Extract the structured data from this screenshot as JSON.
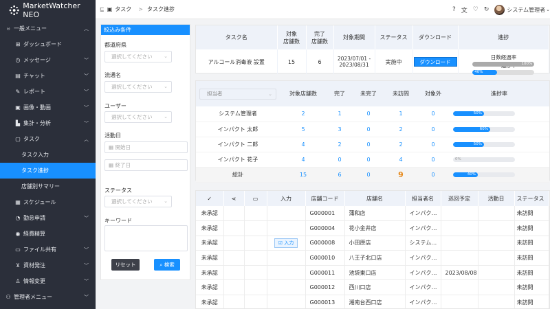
{
  "app": {
    "name": "MarketWatcher NEO"
  },
  "sidebar": {
    "items": [
      {
        "label": "一般メニュー",
        "level": 0,
        "icon": "user-icon",
        "chevron": "up"
      },
      {
        "label": "ダッシュボード",
        "level": 1,
        "icon": "grid-icon",
        "chevron": ""
      },
      {
        "label": "メッセージ",
        "level": 1,
        "icon": "message-icon",
        "chevron": "down"
      },
      {
        "label": "チャット",
        "level": 1,
        "icon": "chat-icon",
        "chevron": "down"
      },
      {
        "label": "レポート",
        "level": 1,
        "icon": "pen-icon",
        "chevron": "down"
      },
      {
        "label": "画像・動画",
        "level": 1,
        "icon": "image-icon",
        "chevron": "down"
      },
      {
        "label": "集計・分析",
        "level": 1,
        "icon": "chart-icon",
        "chevron": "down"
      },
      {
        "label": "タスク",
        "level": 1,
        "icon": "task-icon",
        "chevron": "up"
      },
      {
        "label": "タスク入力",
        "level": 2,
        "icon": "",
        "chevron": ""
      },
      {
        "label": "タスク進捗",
        "level": 2,
        "icon": "",
        "chevron": "",
        "active": true
      },
      {
        "label": "店舗別サマリー",
        "level": 2,
        "icon": "",
        "chevron": ""
      },
      {
        "label": "スケジュール",
        "level": 1,
        "icon": "calendar-icon",
        "chevron": ""
      },
      {
        "label": "勤怠申請",
        "level": 1,
        "icon": "clock-icon",
        "chevron": "down"
      },
      {
        "label": "経費精算",
        "level": 1,
        "icon": "money-icon",
        "chevron": ""
      },
      {
        "label": "ファイル共有",
        "level": 1,
        "icon": "folder-icon",
        "chevron": "down"
      },
      {
        "label": "資材発注",
        "level": 1,
        "icon": "cart-icon",
        "chevron": "down"
      },
      {
        "label": "情報変更",
        "level": 1,
        "icon": "person-icon",
        "chevron": "down"
      },
      {
        "label": "管理者メニュー",
        "level": 0,
        "icon": "admin-icon",
        "chevron": "down"
      }
    ]
  },
  "breadcrumb": {
    "parent": "タスク",
    "current": "タスク進捗",
    "separator": ">"
  },
  "header": {
    "user": "システム管理者"
  },
  "filter": {
    "title": "絞込み条件",
    "prefecture_label": "都道府県",
    "prefecture_placeholder": "選択してください",
    "channel_label": "流通名",
    "channel_placeholder": "選択してください",
    "user_label": "ユーザー",
    "user_placeholder": "選択してください",
    "date_label": "活動日",
    "start_placeholder": "開始日",
    "end_placeholder": "終了日",
    "status_label": "ステータス",
    "status_placeholder": "選択してください",
    "keyword_label": "キーワード",
    "reset_label": "リセット",
    "search_label": "検索"
  },
  "task_table": {
    "headers": [
      "タスク名",
      "対象\n店舗数",
      "完了\n店舗数",
      "対象期間",
      "ステータス",
      "ダウンロード",
      "進捗"
    ],
    "row": {
      "name": "アルコール消毒液 設置",
      "target": "15",
      "done": "6",
      "period": "2023/07/01 -\n2023/08/31",
      "status": "実施中",
      "download": "ダウンロード",
      "days_label": "日数経過率",
      "days_pct": 100,
      "days_text": "100%",
      "progress_label": "進捗率",
      "progress_pct": 40,
      "progress_text": "40%"
    }
  },
  "assignee_table": {
    "select_placeholder": "担当者",
    "headers": [
      "対象店舗数",
      "完了",
      "未完了",
      "未訪問",
      "対象外",
      "進捗率"
    ],
    "rows": [
      {
        "name": "システム管理者",
        "target": "2",
        "done": "1",
        "undone": "0",
        "unvisited": "1",
        "excluded": "0",
        "pct": 50,
        "pct_text": "50%"
      },
      {
        "name": "インパクト 太郎",
        "target": "5",
        "done": "3",
        "undone": "0",
        "unvisited": "2",
        "excluded": "0",
        "pct": 60,
        "pct_text": "60%"
      },
      {
        "name": "インパクト 二郎",
        "target": "4",
        "done": "2",
        "undone": "0",
        "unvisited": "2",
        "excluded": "0",
        "pct": 50,
        "pct_text": "50%"
      },
      {
        "name": "インパクト 花子",
        "target": "4",
        "done": "0",
        "undone": "0",
        "unvisited": "4",
        "excluded": "0",
        "pct": 0,
        "pct_text": "0%"
      }
    ],
    "total": {
      "name": "総計",
      "target": "15",
      "done": "6",
      "undone": "0",
      "unvisited": "9",
      "excluded": "0",
      "pct": 40,
      "pct_text": "40%"
    }
  },
  "store_table": {
    "headers": [
      "入力",
      "店舗コード",
      "店舗名",
      "担当者名",
      "巡回予定",
      "活動日",
      "ステータス"
    ],
    "input_label": "入力",
    "rows": [
      {
        "approval": "未承認",
        "input": false,
        "code": "G000001",
        "store": "蒲和店",
        "assignee": "インパク…",
        "planned": "",
        "date": "",
        "status": "未訪問"
      },
      {
        "approval": "未承認",
        "input": false,
        "code": "G000004",
        "store": "花小金井店",
        "assignee": "インパク…",
        "planned": "",
        "date": "",
        "status": "未訪問"
      },
      {
        "approval": "未承認",
        "input": true,
        "code": "G000008",
        "store": "小田原店",
        "assignee": "システム…",
        "planned": "",
        "date": "",
        "status": "未訪問"
      },
      {
        "approval": "未承認",
        "input": false,
        "code": "G000010",
        "store": "八王子北口店",
        "assignee": "インパク…",
        "planned": "",
        "date": "",
        "status": "未訪問"
      },
      {
        "approval": "未承認",
        "input": false,
        "code": "G000011",
        "store": "池袋東口店",
        "assignee": "インパク…",
        "planned": "2023/08/08",
        "date": "",
        "status": "未訪問"
      },
      {
        "approval": "未承認",
        "input": false,
        "code": "G000012",
        "store": "西川口店",
        "assignee": "インパク…",
        "planned": "",
        "date": "",
        "status": "未訪問"
      },
      {
        "approval": "未承認",
        "input": false,
        "code": "G000013",
        "store": "湘南台西口店",
        "assignee": "インパク…",
        "planned": "",
        "date": "",
        "status": "未訪問"
      }
    ]
  },
  "colors": {
    "sidebar": "#2b2f3a",
    "accent": "#1890ff",
    "bar_gray": "#aaaaaa",
    "orange": "#e6891a"
  }
}
